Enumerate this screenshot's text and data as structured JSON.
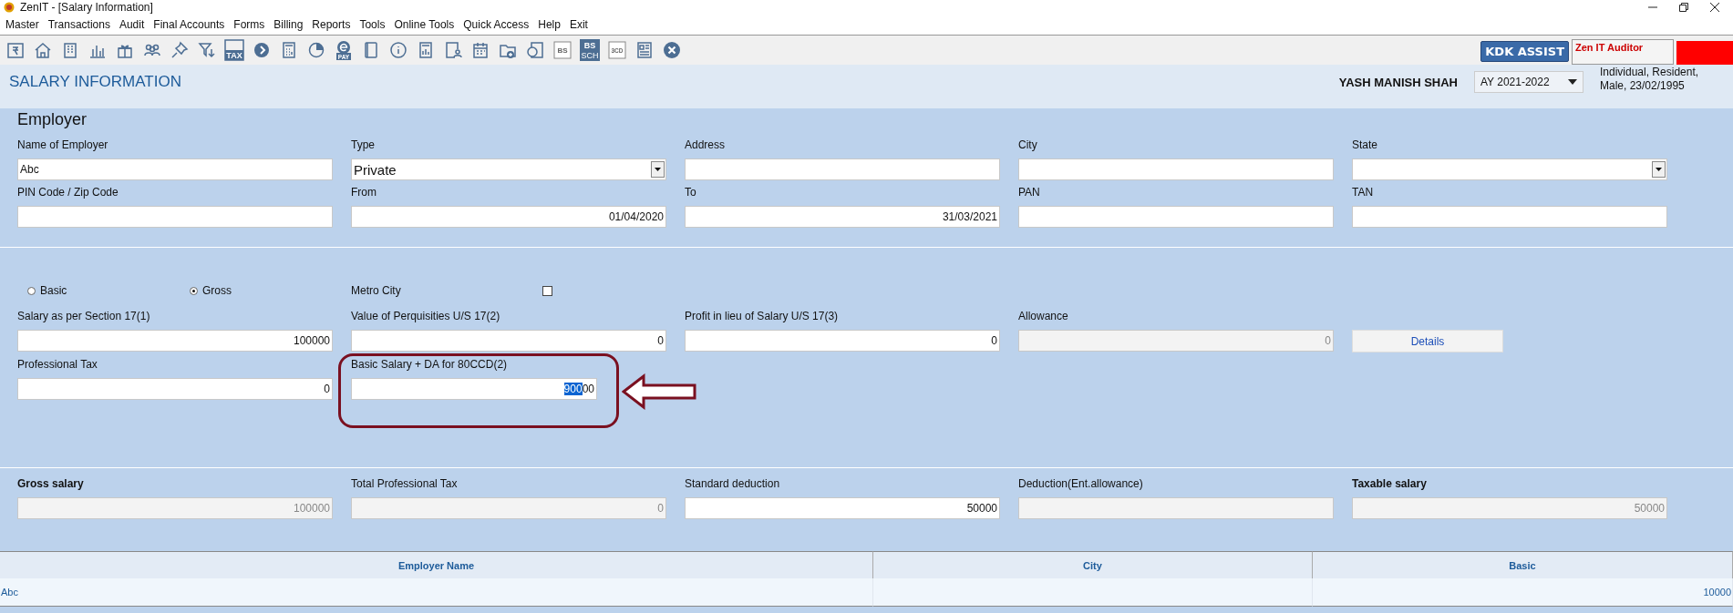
{
  "window": {
    "title": "ZenIT - [Salary Information]"
  },
  "menu": [
    "Master",
    "Transactions",
    "Audit",
    "Final Accounts",
    "Forms",
    "Billing",
    "Reports",
    "Tools",
    "Online Tools",
    "Quick Access",
    "Help",
    "Exit"
  ],
  "toolbar": [
    {
      "kind": "rupee"
    },
    {
      "kind": "house"
    },
    {
      "kind": "building"
    },
    {
      "kind": "bars"
    },
    {
      "kind": "gift"
    },
    {
      "kind": "people"
    },
    {
      "kind": "pin"
    },
    {
      "kind": "filter"
    },
    {
      "kind": "tax",
      "label": "TAX"
    },
    {
      "kind": "disc"
    },
    {
      "kind": "calculator"
    },
    {
      "kind": "pie"
    },
    {
      "kind": "epay",
      "label": "PAY"
    },
    {
      "kind": "book"
    },
    {
      "kind": "info"
    },
    {
      "kind": "report"
    },
    {
      "kind": "userdoc"
    },
    {
      "kind": "calendar"
    },
    {
      "kind": "folder"
    },
    {
      "kind": "circledoc"
    },
    {
      "kind": "boxtext",
      "label": "BS"
    },
    {
      "kind": "bssch",
      "label": "BS",
      "sublabel": "SCH"
    },
    {
      "kind": "boxtext",
      "label": "3CD"
    },
    {
      "kind": "grid"
    },
    {
      "kind": "close"
    }
  ],
  "assist_button": "KDK ASSIST",
  "auditor_label": "Zen IT Auditor",
  "page_title": "SALARY INFORMATION",
  "assessee": {
    "name": "YASH MANISH SHAH",
    "year": "AY 2021-2022",
    "details": "Individual, Resident, Male, 23/02/1995"
  },
  "section_title": "Employer",
  "employer_rows": [
    [
      {
        "label": "Name of Employer",
        "kind": "text",
        "value": "Abc"
      },
      {
        "label": "Type",
        "kind": "dropdown",
        "value": "Private"
      },
      {
        "label": "Address",
        "kind": "text"
      },
      {
        "label": "City",
        "kind": "text"
      },
      {
        "label": "State",
        "kind": "dropdown"
      }
    ],
    [
      {
        "label": "PIN Code / Zip Code",
        "kind": "text"
      },
      {
        "label": "From",
        "kind": "date",
        "value": "01/04/2020"
      },
      {
        "label": "To",
        "kind": "date",
        "value": "31/03/2021"
      },
      {
        "label": "PAN",
        "kind": "text"
      },
      {
        "label": "TAN",
        "kind": "text"
      }
    ]
  ],
  "salary_mode": [
    {
      "label": "Basic",
      "selected": false
    },
    {
      "label": "Gross",
      "selected": true
    }
  ],
  "metro_city": {
    "label": "Metro City",
    "checked": false
  },
  "salary_rows": [
    [
      {
        "label": "Salary as per Section 17(1)",
        "kind": "number",
        "value": "100000"
      },
      {
        "label": "Value of Perquisities U/S 17(2)",
        "kind": "number",
        "value": "0"
      },
      {
        "label": "Profit in lieu of Salary U/S 17(3)",
        "kind": "number",
        "value": "0"
      },
      {
        "label": "Allowance",
        "kind": "number",
        "value": "0",
        "disabled": true
      },
      {
        "kind": "button",
        "label": "Details"
      }
    ],
    [
      {
        "label": "Professional Tax",
        "kind": "number",
        "value": "0"
      },
      {
        "label": "Basic Salary + DA for 80CCD(2)",
        "kind": "number",
        "value_parts": [
          {
            "text": "900",
            "selected": true
          },
          {
            "text": "00",
            "selected": false
          }
        ]
      }
    ]
  ],
  "totals": [
    {
      "label": "Gross salary",
      "bold": true,
      "kind": "number",
      "value": "100000",
      "disabled": true
    },
    {
      "label": "Total Professional Tax",
      "bold": false,
      "kind": "number",
      "value": "0",
      "disabled": true
    },
    {
      "label": "Standard deduction",
      "bold": false,
      "kind": "number",
      "value": "50000",
      "disabled": false
    },
    {
      "label": "Deduction(Ent.allowance)",
      "bold": false,
      "kind": "number",
      "disabled": true
    },
    {
      "label": "Taxable salary",
      "bold": true,
      "kind": "number",
      "value": "50000",
      "disabled": true
    }
  ],
  "table": {
    "columns": [
      "Employer Name",
      "City",
      "Basic"
    ],
    "rows": [
      [
        "Abc",
        "",
        "10000"
      ]
    ]
  }
}
